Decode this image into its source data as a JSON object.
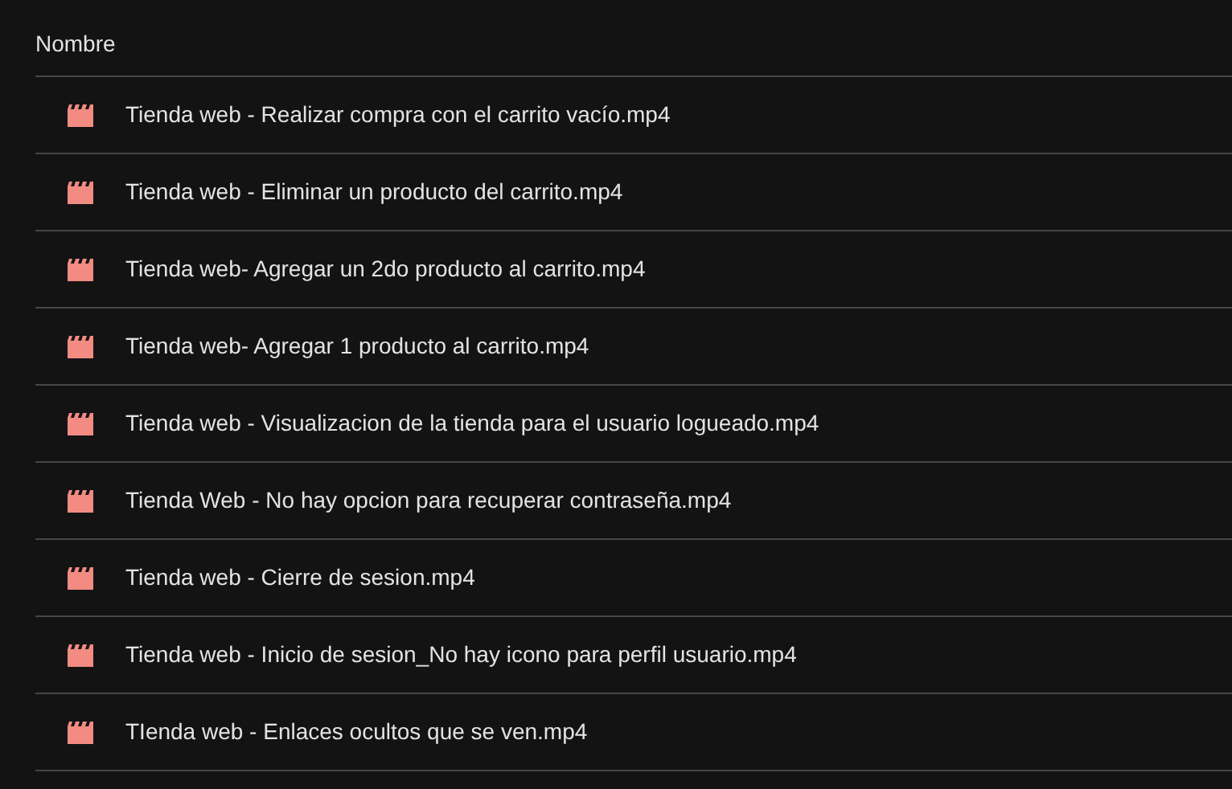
{
  "table": {
    "columns": [
      "Nombre"
    ],
    "rows": [
      {
        "name": "Tienda web - Realizar compra con el carrito vacío.mp4"
      },
      {
        "name": "Tienda web - Eliminar un producto del carrito.mp4"
      },
      {
        "name": "Tienda web- Agregar un 2do producto al carrito.mp4"
      },
      {
        "name": "Tienda web- Agregar 1 producto al carrito.mp4"
      },
      {
        "name": "Tienda web - Visualizacion de la tienda para el usuario logueado.mp4"
      },
      {
        "name": "Tienda Web - No hay opcion para recuperar contraseña.mp4"
      },
      {
        "name": "Tienda web - Cierre de sesion.mp4"
      },
      {
        "name": "Tienda web - Inicio de sesion_No hay icono para perfil usuario.mp4"
      },
      {
        "name": "TIenda web - Enlaces ocultos que se ven.mp4"
      }
    ]
  }
}
